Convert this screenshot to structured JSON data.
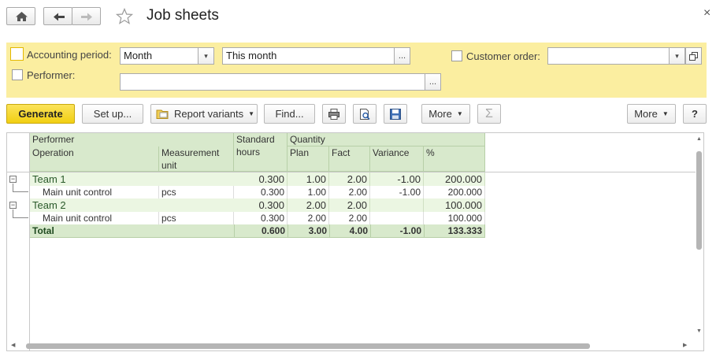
{
  "window": {
    "title": "Job sheets",
    "close_glyph": "×"
  },
  "nav": {
    "home_icon": "home-icon",
    "back_icon": "back-arrow-icon",
    "forward_icon": "forward-arrow-icon",
    "favorite_icon": "star-icon"
  },
  "filters": {
    "accounting_period_label": "Accounting period:",
    "period_type": "Month",
    "period_value": "This month",
    "performer_label": "Performer:",
    "performer_value": "",
    "customer_order_label": "Customer order:",
    "customer_order_value": "",
    "ellipsis": "..."
  },
  "toolbar": {
    "generate": "Generate",
    "setup": "Set up...",
    "report_variants": "Report variants",
    "find": "Find...",
    "more_left": "More",
    "more_right": "More",
    "help": "?",
    "sigma": "Σ"
  },
  "table": {
    "headers": {
      "performer": "Performer",
      "operation": "Operation",
      "measurement_unit_1": "Measurement",
      "measurement_unit_2": "unit",
      "standard_hours_1": "Standard",
      "standard_hours_2": "hours",
      "quantity": "Quantity",
      "plan": "Plan",
      "fact": "Fact",
      "variance": "Variance",
      "percent": "%"
    },
    "rows": [
      {
        "name": "Team 1",
        "unit": "",
        "hours": "0.300",
        "plan": "1.00",
        "fact": "2.00",
        "variance": "-1.00",
        "percent": "200.000"
      },
      {
        "name": "Main unit control",
        "unit": "pcs",
        "hours": "0.300",
        "plan": "1.00",
        "fact": "2.00",
        "variance": "-1.00",
        "percent": "200.000"
      },
      {
        "name": "Team 2",
        "unit": "",
        "hours": "0.300",
        "plan": "2.00",
        "fact": "2.00",
        "variance": "",
        "percent": "100.000"
      },
      {
        "name": "Main unit control",
        "unit": "pcs",
        "hours": "0.300",
        "plan": "2.00",
        "fact": "2.00",
        "variance": "",
        "percent": "100.000"
      }
    ],
    "total": {
      "name": "Total",
      "hours": "0.600",
      "plan": "3.00",
      "fact": "4.00",
      "variance": "-1.00",
      "percent": "133.333"
    }
  },
  "colors": {
    "accent_yellow": "#f5d622",
    "filter_bg": "#fbeea0",
    "header_green": "#d8e9cc",
    "group_green": "#ebf6e2"
  }
}
